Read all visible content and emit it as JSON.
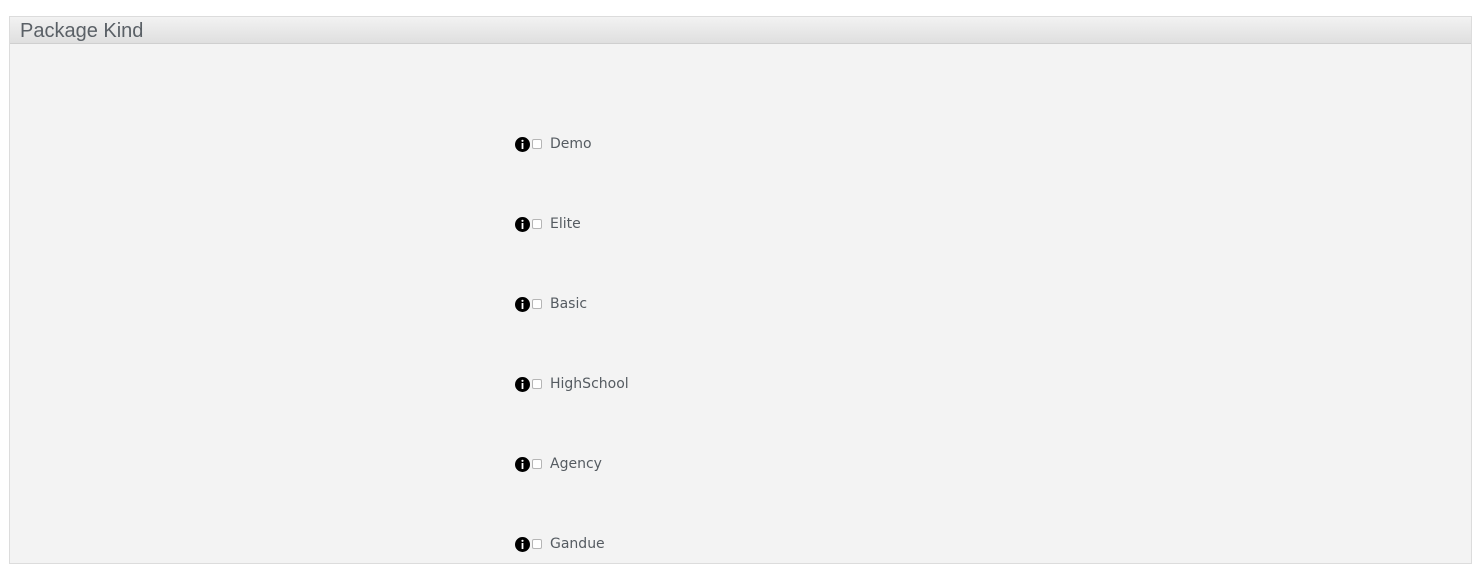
{
  "panel": {
    "title": "Package Kind"
  },
  "options": [
    {
      "label": "Demo",
      "checked": false,
      "icon": "info-icon"
    },
    {
      "label": "Elite",
      "checked": false,
      "icon": "info-icon"
    },
    {
      "label": "Basic",
      "checked": false,
      "icon": "info-icon"
    },
    {
      "label": "HighSchool",
      "checked": false,
      "icon": "info-icon"
    },
    {
      "label": "Agency",
      "checked": false,
      "icon": "info-icon"
    },
    {
      "label": "Gandue",
      "checked": false,
      "icon": "info-icon"
    }
  ]
}
